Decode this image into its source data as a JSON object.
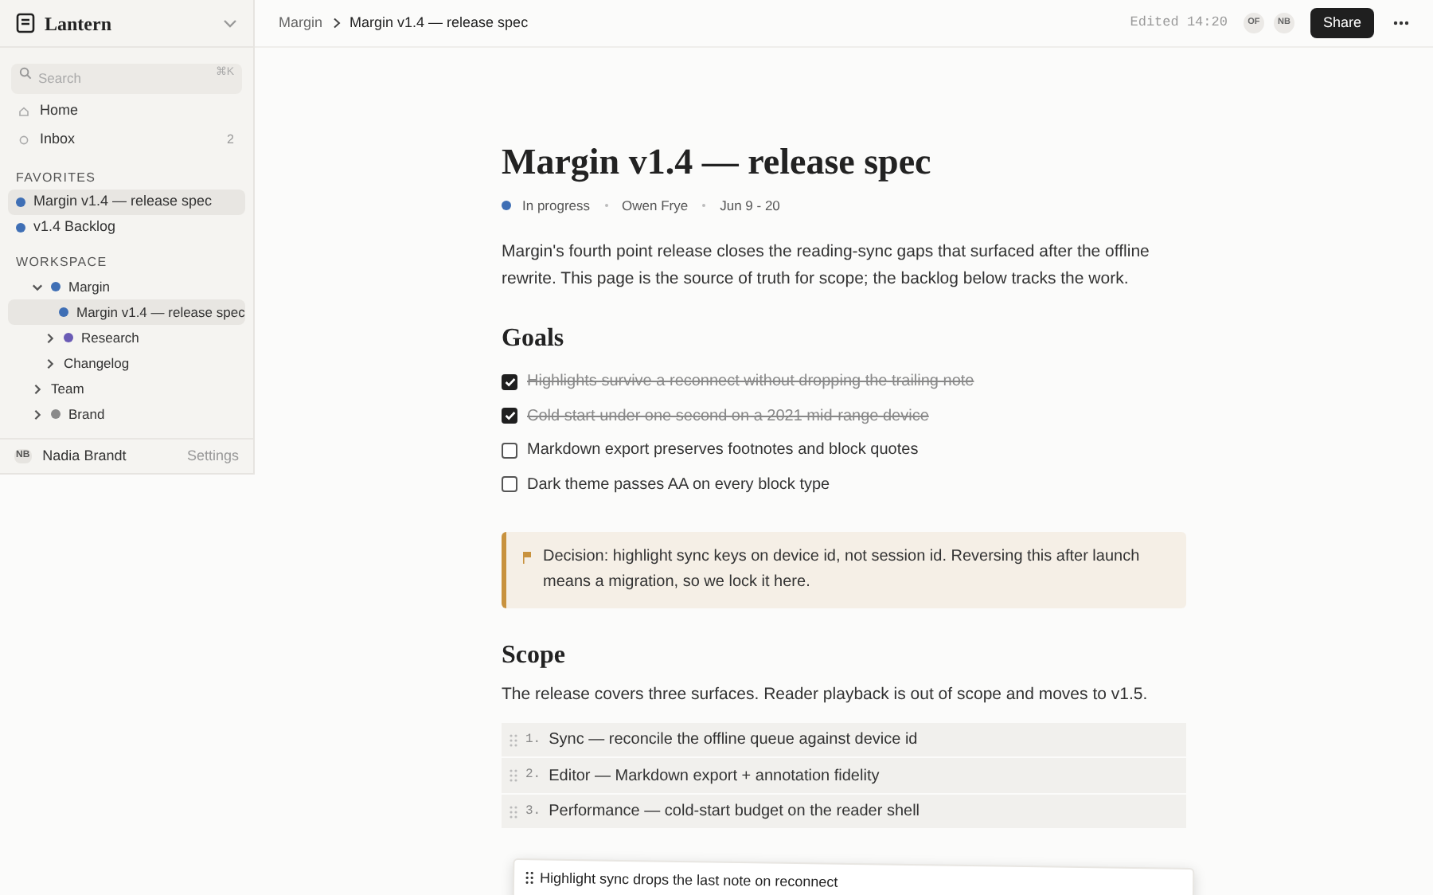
{
  "workspace": {
    "name": "Lantern"
  },
  "search": {
    "placeholder": "Search",
    "shortcut": "⌘K"
  },
  "nav": [
    {
      "label": "Home",
      "kind": "home"
    },
    {
      "label": "Inbox",
      "kind": "inbox",
      "count": "2"
    }
  ],
  "favorites": {
    "heading": "FAVORITES",
    "items": [
      {
        "label": "Margin v1.4 — release spec",
        "color": "#3f6fb5",
        "selected": true
      },
      {
        "label": "v1.4 Backlog",
        "color": "#3f6fb5",
        "selected": false
      }
    ]
  },
  "workspace_tree": {
    "heading": "WORKSPACE",
    "items": [
      {
        "label": "Margin",
        "color": "#3f6fb5",
        "expanded": true,
        "selected": false,
        "children": [
          {
            "label": "Margin v1.4 — release spec",
            "color": "#3f6fb5",
            "selected": true
          },
          {
            "label": "Research",
            "color": "#6a5bb5",
            "expanded": false,
            "selected": false
          },
          {
            "label": "Changelog",
            "expanded": false,
            "selected": false
          }
        ]
      },
      {
        "label": "Team",
        "expanded": false,
        "selected": false
      },
      {
        "label": "Brand",
        "color": "#8a8a8a",
        "expanded": false,
        "selected": false
      }
    ]
  },
  "user": {
    "initials": "NB",
    "name": "Nadia Brandt",
    "settings": "Settings"
  },
  "breadcrumb": [
    "Margin",
    "Margin v1.4 — release spec"
  ],
  "topbar": {
    "edited": "Edited 14:20",
    "avatars": [
      "OF",
      "NB"
    ],
    "share": "Share"
  },
  "page": {
    "title": "Margin v1.4 — release spec",
    "meta": {
      "status": {
        "label": "In progress",
        "color": "#3f6fb5"
      },
      "owner": "Owen Frye",
      "dates": "Jun 9 - 20"
    },
    "intro": "Margin's fourth point release closes the reading-sync gaps that surfaced after the offline rewrite. This page is the source of truth for scope; the backlog below tracks the work.",
    "goals_heading": "Goals",
    "goals": [
      {
        "text": "Highlights survive a reconnect without dropping the trailing note",
        "checked": true
      },
      {
        "text": "Cold start under one second on a 2021 mid-range device",
        "checked": true
      },
      {
        "text": "Markdown export preserves footnotes and block quotes",
        "checked": false
      },
      {
        "text": "Dark theme passes AA on every block type",
        "checked": false
      }
    ],
    "callout": "Decision: highlight sync keys on device id, not session id. Reversing this after launch means a migration, so we lock it here.",
    "scope_heading": "Scope",
    "scope_intro": "The release covers three surfaces. Reader playback is out of scope and moves to v1.5.",
    "scope_items": [
      {
        "number": "1.",
        "text": "Sync — reconcile the offline queue against device id"
      },
      {
        "number": "2.",
        "text": "Editor — Markdown export + annotation fidelity"
      },
      {
        "number": "3.",
        "text": "Performance — cold-start budget on the reader shell"
      }
    ],
    "dragged_card": "Highlight sync drops the last note on reconnect"
  }
}
